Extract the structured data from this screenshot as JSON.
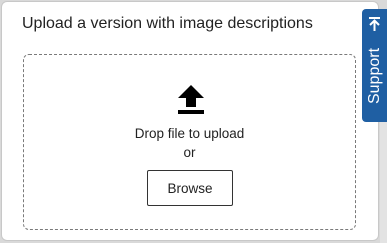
{
  "upload": {
    "heading": "Upload a version with image descriptions",
    "drop_text": "Drop file to upload",
    "or_text": "or",
    "browse_label": "Browse",
    "icon": "upload-icon"
  },
  "support_tab": {
    "label": "Support",
    "icon": "collapse-arrow-icon"
  },
  "colors": {
    "support_bg": "#1f5fa3",
    "text": "#222222",
    "dashed_border": "#7a7a7a"
  }
}
